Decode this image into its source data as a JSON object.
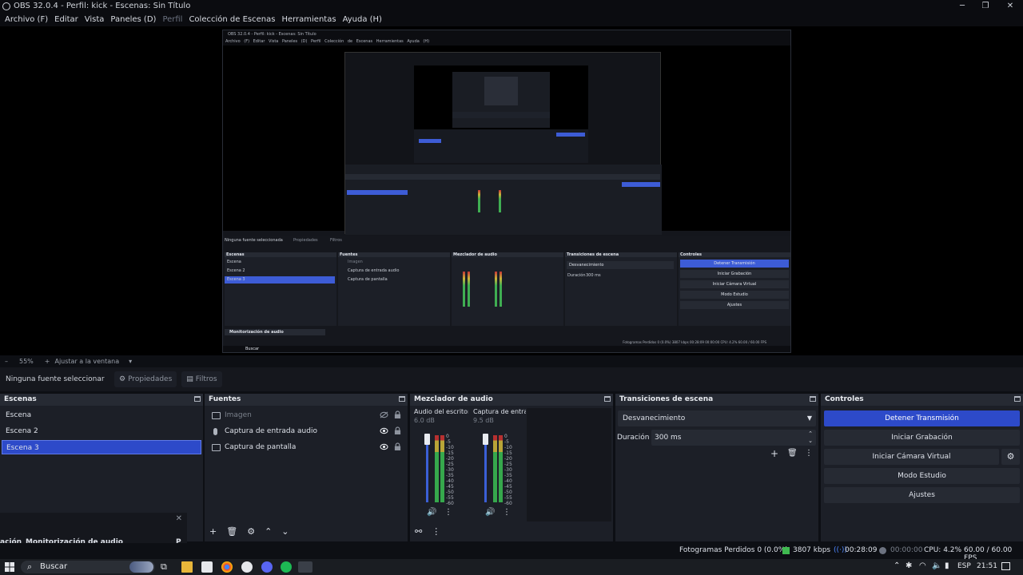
{
  "window": {
    "title": "OBS 32.0.4 - Perfil: kick - Escenas: Sin Título",
    "minimize": "─",
    "restore": "❐",
    "close": "✕"
  },
  "menu": [
    {
      "label": "Archivo (F)",
      "dim": false
    },
    {
      "label": "Editar",
      "dim": false
    },
    {
      "label": "Vista",
      "dim": false
    },
    {
      "label": "Paneles (D)",
      "dim": false
    },
    {
      "label": "Perfil",
      "dim": true
    },
    {
      "label": "Colección de Escenas",
      "dim": false
    },
    {
      "label": "Herramientas",
      "dim": false
    },
    {
      "label": "Ayuda (H)",
      "dim": false
    }
  ],
  "preview": {
    "inner_title": "OBS 32.0.4 - Perfil: kick - Escenas: Sin Título",
    "inner_menu": "Archivo (F)  Editar  Vista  Paneles (D)  Perfil  Colección de Escenas  Herramientas  Ayuda (H)",
    "mini": {
      "no_source": "Ninguna fuente seleccionada",
      "props": "Propiedades",
      "filters": "Filtros",
      "scenes_hdr": "Escenas",
      "sources_hdr": "Fuentes",
      "mixer_hdr": "Mezclador de audio",
      "transitions_hdr": "Transiciones de escena",
      "controls_hdr": "Controles",
      "scenes": [
        "Escena",
        "Escena 2",
        "Escena 3"
      ],
      "sources": [
        "Imagen",
        "Captura de entrada audio",
        "Captura de pantalla"
      ],
      "transition": "Desvanecimiento",
      "duration_label": "Duración",
      "duration": "300 ms",
      "buttons": [
        "Detener Transmisión",
        "Iniciar Grabación",
        "Iniciar Cámara Virtual",
        "Modo Estudio",
        "Ajustes"
      ],
      "audio_monitor": "Monitorización de audio",
      "status": "Fotogramas Perdidos 0 (0.0%)   3807 kbps   00:28:09   00:00:00   CPU: 4.2%   60.00 / 60.00 FPS",
      "search": "Buscar"
    }
  },
  "zoom": {
    "minus": "–",
    "value": "55%",
    "plus": "+",
    "fit": "Ajustar a la ventana",
    "chevron": "▾"
  },
  "source_bar": {
    "none_selected": "Ninguna fuente seleccionar",
    "properties": "Propiedades",
    "filters": "Filtros"
  },
  "scenes": {
    "header": "Escenas",
    "items": [
      "Escena",
      "Escena 2",
      "Escena 3"
    ],
    "selected_index": 2
  },
  "sources": {
    "header": "Fuentes",
    "items": [
      {
        "name": "Imagen",
        "type": "image",
        "visible": false
      },
      {
        "name": "Captura de entrada audio",
        "type": "mic",
        "visible": true
      },
      {
        "name": "Captura de pantalla",
        "type": "monitor",
        "visible": true
      }
    ],
    "toolbar": [
      "+",
      "🗑",
      "⚙",
      "⌃",
      "⌄"
    ]
  },
  "mixer": {
    "header": "Mezclador de audio",
    "channels": [
      {
        "name": "Audio del escritorio",
        "db": "6.0 dB"
      },
      {
        "name": "Captura de entrada",
        "db": "9.5 dB"
      }
    ],
    "scale": [
      "0",
      "-5",
      "-10",
      "-15",
      "-20",
      "-25",
      "-30",
      "-35",
      "-40",
      "-45",
      "-50",
      "-55",
      "-60"
    ],
    "speaker": "🔊",
    "more": "⋮",
    "link": "⚯"
  },
  "transitions": {
    "header": "Transiciones de escena",
    "selected": "Desvanecimiento",
    "duration_label": "Duración",
    "duration": "300 ms",
    "add": "+",
    "remove": "🗑",
    "more": "⋮"
  },
  "controls": {
    "header": "Controles",
    "buttons": [
      "Detener Transmisión",
      "Iniciar Grabación",
      "Iniciar Cámara Virtual",
      "Modo Estudio",
      "Ajustes"
    ],
    "gear": "⚙"
  },
  "floating": {
    "close": "✕",
    "left_label": "ación",
    "title": "Monitorización de audio",
    "p": "P"
  },
  "status": {
    "dropped": "Fotogramas Perdidos 0 (0.0%)",
    "kbps": "3807 kbps",
    "stream_time": "00:28:09",
    "rec_time": "00:00:00",
    "cpu": "CPU: 4.2%",
    "fps": "60.00 / 60.00 FPS"
  },
  "taskbar": {
    "search": "Buscar",
    "lang": "ESP",
    "time": "21:51"
  },
  "colors": {
    "accent": "#2d4ac9",
    "meter_green": "#36a84c",
    "meter_yellow": "#b9a537",
    "meter_red": "#b73030",
    "live_green": "#3fb950"
  }
}
